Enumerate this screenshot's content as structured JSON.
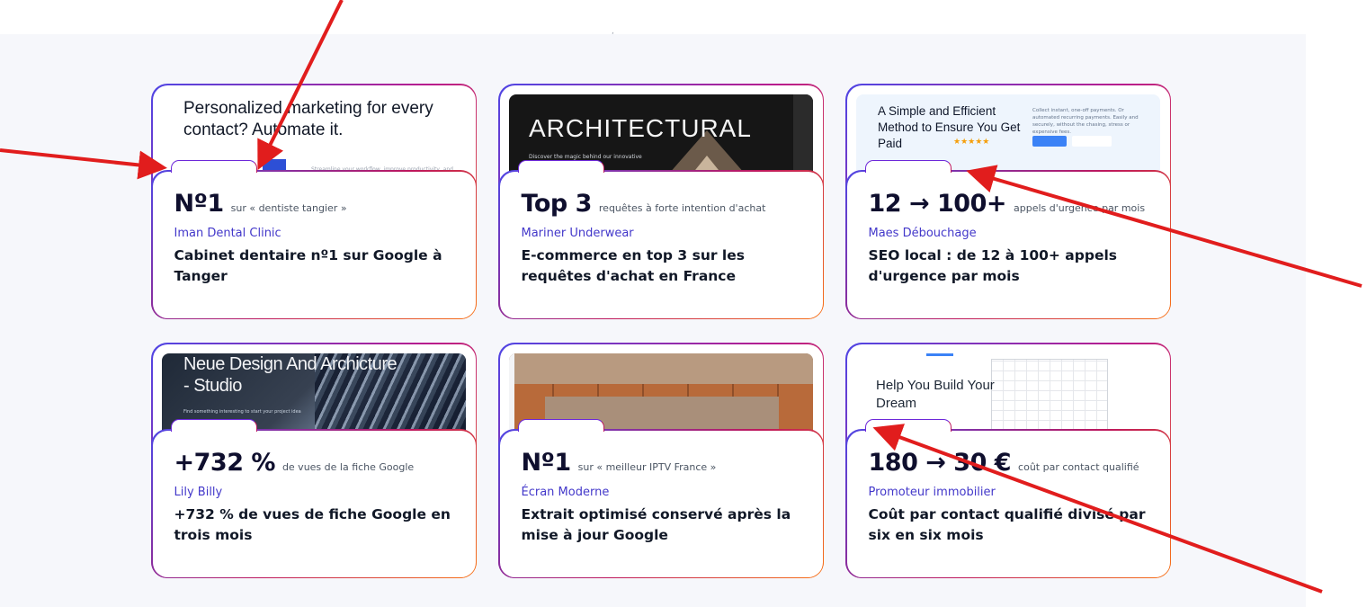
{
  "header_fragment": ", ",
  "thumbnails": {
    "t1": {
      "headline": "Personalized marketing for every contact? Automate it.",
      "sub": "Streamline your workflow, improve productivity, and grow with"
    },
    "t2": {
      "headline": "ARCHITECTURAL",
      "sub": "Discover the magic behind our innovative"
    },
    "t3": {
      "headline": "A Simple and Efficient Method to Ensure You Get Paid",
      "para": "Collect instant, one-off payments. Or automated recurring payments. Easily and securely, without the chasing, stress or expensive fees.",
      "stars": "★★★★★"
    },
    "t4": {
      "headline": "Neue Design And Archicture - Studio",
      "sub": "Find something interesting to start your project idea"
    },
    "t6": {
      "headline": "Help You Build Your Dream"
    }
  },
  "cards": [
    {
      "metric": "Nº1",
      "metric_desc": "sur « dentiste tangier »",
      "client": "Iman Dental Clinic",
      "title": "Cabinet dentaire nº1 sur Google à Tanger"
    },
    {
      "metric": "Top 3",
      "metric_desc": "requêtes à forte intention d'achat",
      "client": "Mariner Underwear",
      "title": "E-commerce en top 3 sur les requêtes d'achat en France"
    },
    {
      "metric": "12 → 100+",
      "metric_desc": "appels d'urgence par mois",
      "client": "Maes Débouchage",
      "title": "SEO local : de 12 à 100+ appels d'urgence par mois"
    },
    {
      "metric": "+732 %",
      "metric_desc": "de vues de la fiche Google",
      "client": "Lily Billy",
      "title": "+732 % de vues de fiche Google en trois mois"
    },
    {
      "metric": "Nº1",
      "metric_desc": "sur « meilleur IPTV France »",
      "client": "Écran Moderne",
      "title": "Extrait optimisé conservé après la mise à jour Google"
    },
    {
      "metric": "180 → 30 €",
      "metric_desc": "coût par contact qualifié",
      "client": "Promoteur immobilier",
      "title": "Coût par contact qualifié divisé par six en six mois"
    }
  ],
  "colors": {
    "client": "#4338ca",
    "metric": "#0f0f2e",
    "annotation": "#e11d1d"
  }
}
